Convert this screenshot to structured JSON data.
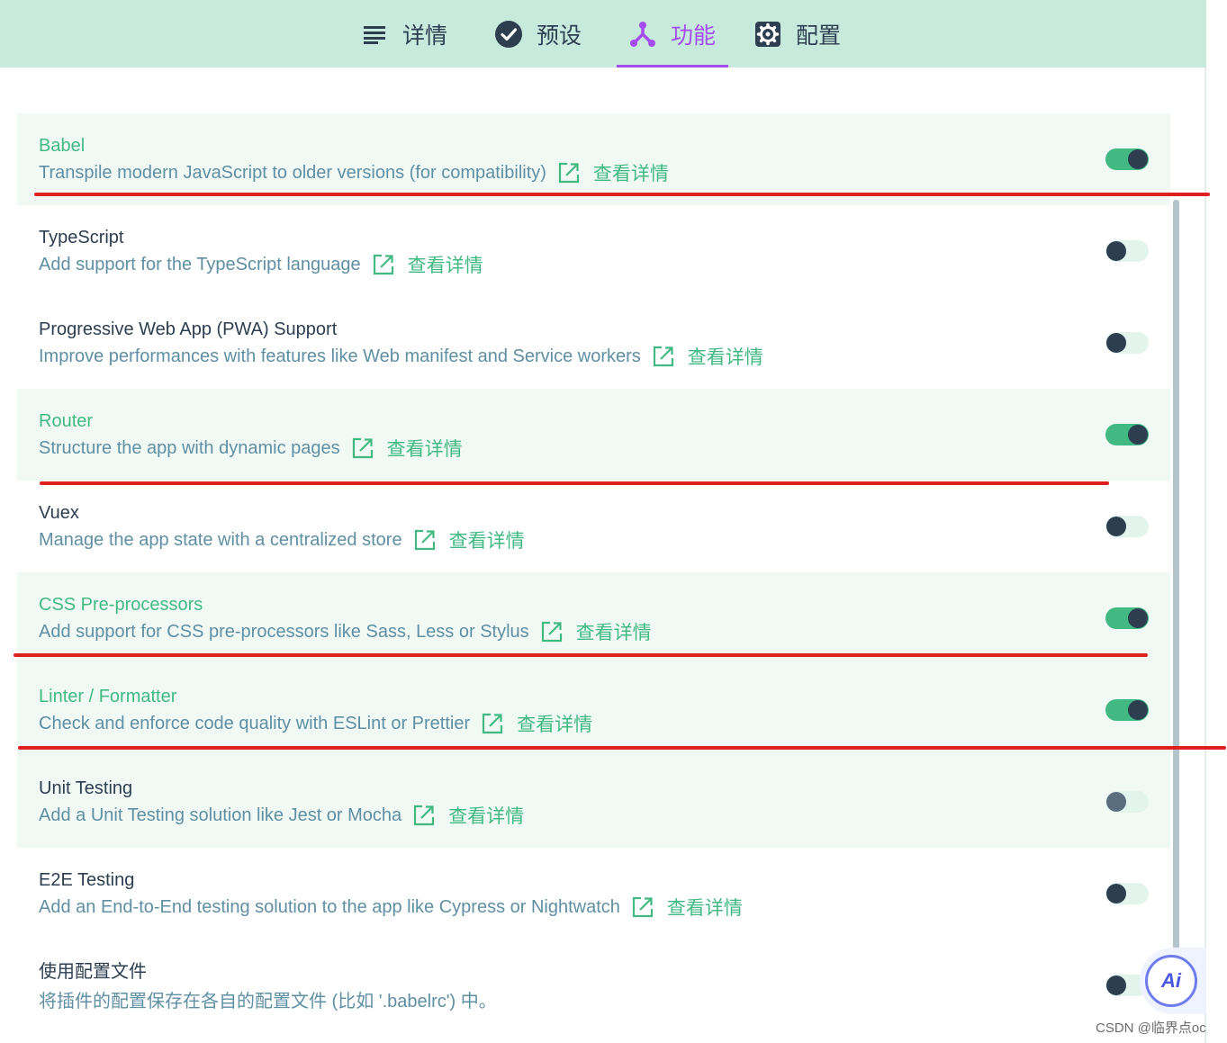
{
  "tabs": [
    {
      "label": "详情",
      "icon": "list-icon"
    },
    {
      "label": "预设",
      "icon": "check-circle-icon"
    },
    {
      "label": "功能",
      "icon": "merge-fork-icon"
    },
    {
      "label": "配置",
      "icon": "gear-icon"
    }
  ],
  "active_tab": "功能",
  "details_link": "查看详情",
  "features": [
    {
      "name": "Babel",
      "desc": "Transpile modern JavaScript to older versions (for compatibility)",
      "enabled": true
    },
    {
      "name": "TypeScript",
      "desc": "Add support for the TypeScript language",
      "enabled": false
    },
    {
      "name": "Progressive Web App (PWA) Support",
      "desc": "Improve performances with features like Web manifest and Service workers",
      "enabled": false
    },
    {
      "name": "Router",
      "desc": "Structure the app with dynamic pages",
      "enabled": true
    },
    {
      "name": "Vuex",
      "desc": "Manage the app state with a centralized store",
      "enabled": false
    },
    {
      "name": "CSS Pre-processors",
      "desc": "Add support for CSS pre-processors like Sass, Less or Stylus",
      "enabled": true
    },
    {
      "name": "Linter / Formatter",
      "desc": "Check and enforce code quality with ESLint or Prettier",
      "enabled": true
    },
    {
      "name": "Unit Testing",
      "desc": "Add a Unit Testing solution like Jest or Mocha",
      "enabled": false
    },
    {
      "name": "E2E Testing",
      "desc": "Add an End-to-End testing solution to the app like Cypress or Nightwatch",
      "enabled": false
    },
    {
      "name": "使用配置文件",
      "desc": "将插件的配置保存在各自的配置文件 (比如 '.babelrc') 中。",
      "enabled": false
    }
  ],
  "ai_button": "Ai",
  "watermark": "CSDN @临界点oc",
  "colors": {
    "accent_green": "#42b983",
    "accent_purple": "#a44cf0",
    "header_bg": "#c8eadd",
    "annotation_red": "#e02020"
  }
}
